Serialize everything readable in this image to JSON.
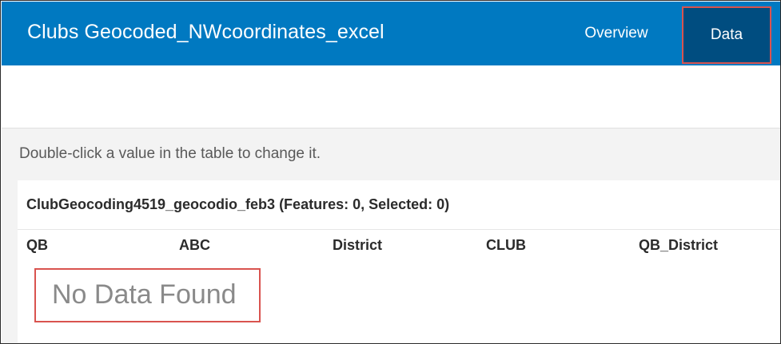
{
  "header": {
    "title": "Clubs Geocoded_NWcoordinates_excel",
    "tabs": [
      {
        "label": "Overview",
        "selected": false
      },
      {
        "label": "Data",
        "selected": true
      }
    ]
  },
  "content": {
    "hint": "Double-click a value in the table to change it.",
    "table": {
      "caption": "ClubGeocoding4519_geocodio_feb3 (Features: 0, Selected: 0)",
      "columns": [
        "QB",
        "ABC",
        "District",
        "CLUB",
        "QB_District"
      ],
      "empty_message": "No Data Found"
    }
  },
  "colors": {
    "header_bg": "#0079c1",
    "active_tab_bg": "#004d80",
    "highlight_border": "#d9534f"
  }
}
